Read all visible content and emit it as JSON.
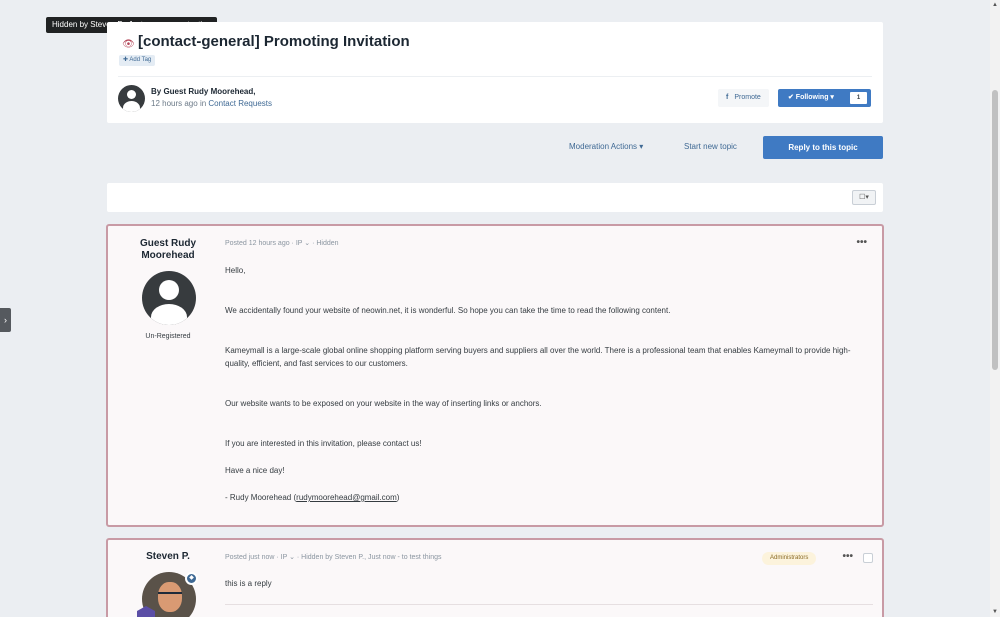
{
  "tooltip": "Hidden by Steven P., Just now - more testing",
  "topic": {
    "title": "[contact-general] Promoting Invitation",
    "add_tag": "✚ Add Tag",
    "by_line": "By Guest Rudy Moorehead,",
    "time": "12 hours ago",
    "in_word": "in",
    "forum": "Contact Requests",
    "promote_label": "Promote",
    "following_label": "✔ Following ▾",
    "following_count": "1"
  },
  "actions": {
    "moderation": "Moderation Actions ▾",
    "start_topic": "Start new topic",
    "reply": "Reply to this topic"
  },
  "post1": {
    "author": "Guest Rudy Moorehead",
    "group": "Un-Registered",
    "meta": "Posted 12 hours ago · IP ⌄ · Hidden",
    "paragraphs": [
      "Hello,",
      "We accidentally found your website of neowin.net, it is wonderful. So hope you can take the time to read the following content.",
      "Kameymall is a large-scale global online shopping platform serving buyers and suppliers all over the world. There is a professional team that enables Kameymall to provide high-quality, efficient, and fast services to our customers.",
      "Our website wants to be exposed on your website in the way of inserting links or anchors.",
      "If you are interested in this invitation, please contact us!",
      "Have a nice day!"
    ],
    "signature_prefix": "- Rudy Moorehead (",
    "email": "rudymoorehead@gmail.com",
    "signature_suffix": ")"
  },
  "post2": {
    "author": "Steven P.",
    "meta": "Posted just now · IP ⌄ · Hidden by Steven P., Just now - to test things",
    "badge": "Administrators",
    "text": "this is a reply"
  },
  "icons": {
    "more": "•••",
    "side_toggle": "›",
    "scroll_up": "▲",
    "scroll_down": "▼",
    "multi_select": "☐▾",
    "hidden": "👁",
    "shield": "◆"
  }
}
